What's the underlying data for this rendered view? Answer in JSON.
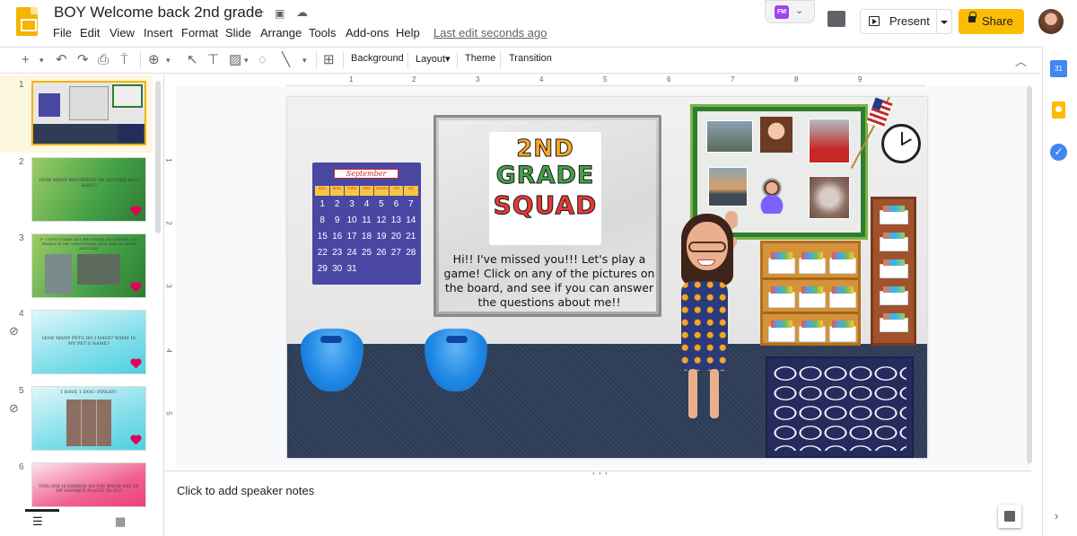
{
  "app": {
    "doc_title": "BOY Welcome back 2nd grade",
    "last_edit": "Last edit seconds ago",
    "present_label": "Present",
    "share_label": "Share",
    "addon_badge": "FM"
  },
  "menu": [
    "File",
    "Edit",
    "View",
    "Insert",
    "Format",
    "Slide",
    "Arrange",
    "Tools",
    "Add-ons",
    "Help"
  ],
  "toolbar": {
    "background_label": "Background",
    "layout_label": "Layout▾",
    "theme_label": "Theme",
    "transition_label": "Transition"
  },
  "ruler": {
    "top": [
      "1",
      "2",
      "3",
      "4",
      "5",
      "6",
      "7",
      "8",
      "9"
    ],
    "left": [
      "1",
      "2",
      "3",
      "4",
      "5"
    ]
  },
  "filmstrip": {
    "slides": [
      {
        "num": "1",
        "text": ""
      },
      {
        "num": "2",
        "text": "How many brothers or sisters do I have?"
      },
      {
        "num": "3",
        "text": "0 - I don't have any brothers or sisters! My family is me, Gentleman Jack and my mom and dad!"
      },
      {
        "num": "4",
        "text": "How many pets do I have? What is my pet's name?"
      },
      {
        "num": "5",
        "text": "I have 1 dog- Finley!"
      },
      {
        "num": "6",
        "text": "This one is harder- do you know any of my favorite places to go?"
      }
    ]
  },
  "slide": {
    "calendar_month": "September",
    "calendar_days": [
      "SUN",
      "MON",
      "TUES",
      "WED",
      "THURS",
      "FRI",
      "SAT"
    ],
    "calendar_dates": [
      "1",
      "2",
      "3",
      "4",
      "5",
      "6",
      "7",
      "8",
      "9",
      "10",
      "11",
      "12",
      "13",
      "14",
      "15",
      "16",
      "17",
      "18",
      "19",
      "20",
      "21",
      "22",
      "23",
      "24",
      "25",
      "26",
      "27",
      "28",
      "29",
      "30",
      "31"
    ],
    "logo_line1": "2ND",
    "logo_line2": "GRADE",
    "logo_line3": "SQUAD",
    "board_message": "Hi!! I've missed you!!! Let's play a game! Click on any of the pictures on the board, and see if you can answer the questions about me!!"
  },
  "notes": {
    "placeholder": "Click to add speaker notes"
  },
  "side_panel": {
    "calendar_label": "31"
  },
  "colors": {
    "accent": "#fbbc04",
    "slides_logo": "#f4b400",
    "selection": "#fef7e0",
    "heart": "#e0005a"
  }
}
